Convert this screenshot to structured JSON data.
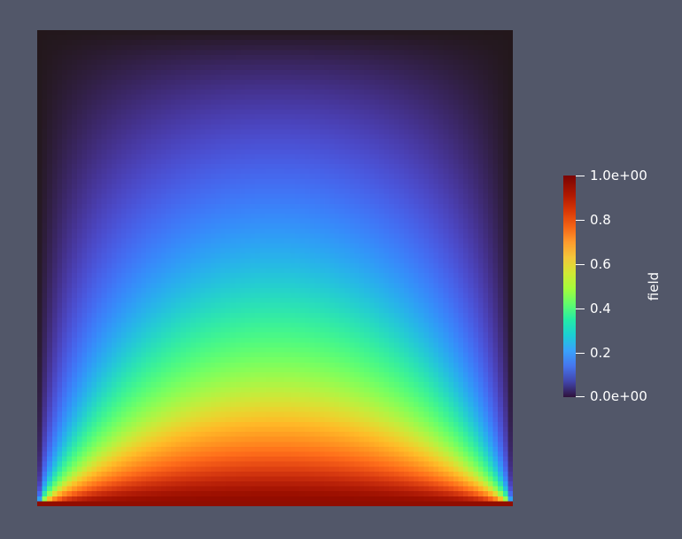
{
  "scene": {
    "background_color": "#525769",
    "colormap": "turbo"
  },
  "colorbar": {
    "title": "field",
    "range": [
      0,
      1
    ],
    "ticks": [
      {
        "value": 1.0,
        "label": "1.0e+00"
      },
      {
        "value": 0.8,
        "label": "0.8"
      },
      {
        "value": 0.6,
        "label": "0.6"
      },
      {
        "value": 0.4,
        "label": "0.4"
      },
      {
        "value": 0.2,
        "label": "0.2"
      },
      {
        "value": 0.0,
        "label": "0.0e+00"
      }
    ]
  }
}
